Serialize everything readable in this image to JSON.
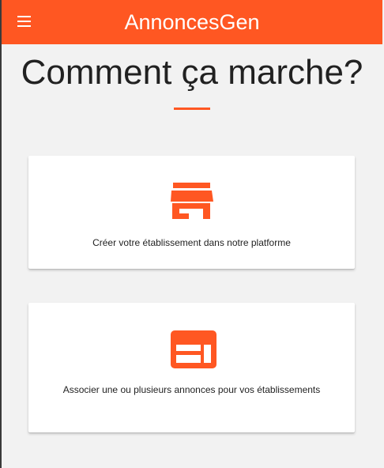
{
  "app": {
    "title": "AnnoncesGen",
    "accent_color": "#ff5722"
  },
  "header": {
    "menu_icon": "hamburger-menu-icon"
  },
  "main": {
    "title": "Comment ça marche?",
    "steps": [
      {
        "icon": "store-icon",
        "text": "Créer votre établissement dans notre platforme"
      },
      {
        "icon": "web-layout-icon",
        "text": "Associer une ou plusieurs annonces pour vos établissements"
      }
    ]
  }
}
